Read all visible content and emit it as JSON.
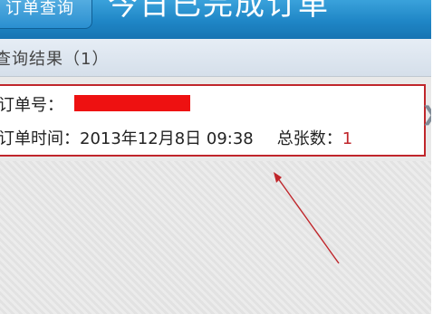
{
  "header": {
    "back_label": "订单查询",
    "title": "今日已完成订单"
  },
  "section": {
    "title": "查询结果（1）"
  },
  "order": {
    "number_label": "订单号：",
    "time_label": "订单时间：",
    "time_value": "2013年12月8日 09:38",
    "count_label": "总张数：",
    "count_value": "1"
  },
  "colors": {
    "header": "#1f86c6",
    "card_border": "#c0262b",
    "redaction": "#ee1111",
    "annotation_arrow": "#c0262b"
  },
  "icons": {
    "detail": "chevron-right-icon",
    "annotation": "red-arrow-annotation"
  }
}
